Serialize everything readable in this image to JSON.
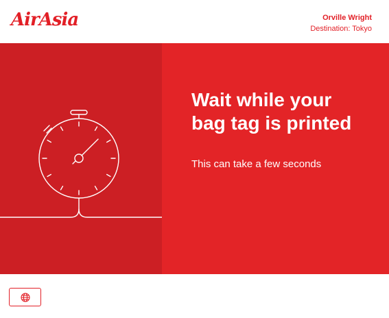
{
  "header": {
    "logo_text": "AirAsia",
    "passenger_name": "Orville Wright",
    "destination": "Destination: Tokyo"
  },
  "main": {
    "headline_line1": "Wait while your",
    "headline_line2": "bag tag is printed",
    "subtext": "This can take a few seconds",
    "illustration_icon": "stopwatch-icon"
  },
  "footer": {
    "language_icon": "globe-icon"
  },
  "colors": {
    "brand_red": "#e21f26",
    "panel_red": "#e32427",
    "panel_dark_red": "#cc1f24"
  }
}
